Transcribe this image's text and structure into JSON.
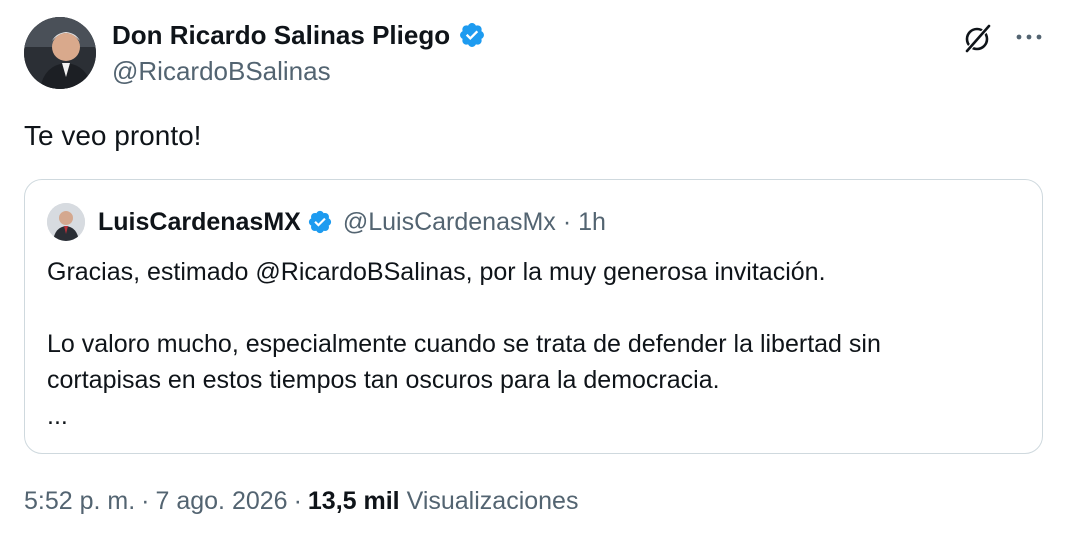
{
  "tweet": {
    "author": {
      "name": "Don Ricardo Salinas Pliego",
      "handle": "@RicardoBSalinas",
      "verified": true
    },
    "text": "Te veo pronto!",
    "quote": {
      "name": "LuisCardenasMX",
      "handle": "@LuisCardenasMx",
      "separator": "·",
      "time": "1h",
      "paragraph1": "Gracias, estimado @RicardoBSalinas, por la muy generosa invitación.",
      "paragraph2_line1": "Lo valoro mucho, especialmente cuando se trata de defender la libertad sin",
      "paragraph2_line2": "cortapisas en estos tiempos tan oscuros para la democracia.",
      "ellipsis": "..."
    },
    "meta": {
      "time": "5:52 p. m.",
      "separator": "·",
      "date": "7 ago. 2026",
      "views_count": "13,5 mil",
      "views_label": "Visualizaciones"
    }
  },
  "icons": {
    "verified": "verified-badge-icon",
    "grok": "grok-icon",
    "more": "more-options-icon"
  },
  "colors": {
    "text_primary": "#0f1419",
    "text_secondary": "#536471",
    "verified_blue": "#1d9bf0",
    "border": "#cfd9de"
  }
}
